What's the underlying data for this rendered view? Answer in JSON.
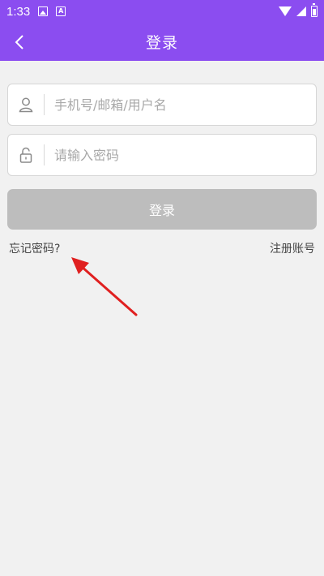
{
  "status_bar": {
    "time": "1:33",
    "left_icons": [
      "image-icon",
      "a-icon"
    ],
    "a_icon_text": "A",
    "right_icons": [
      "wifi-icon",
      "signal-icon",
      "battery-icon"
    ]
  },
  "header": {
    "title": "登录",
    "background": "#8b4df0"
  },
  "form": {
    "username_placeholder": "手机号/邮箱/用户名",
    "username_value": "",
    "password_placeholder": "请输入密码",
    "password_value": "",
    "login_label": "登录",
    "login_button_color": "#bdbdbd"
  },
  "links": {
    "forgot_password": "忘记密码?",
    "register": "注册账号"
  },
  "annotation": {
    "color": "#e02020"
  }
}
